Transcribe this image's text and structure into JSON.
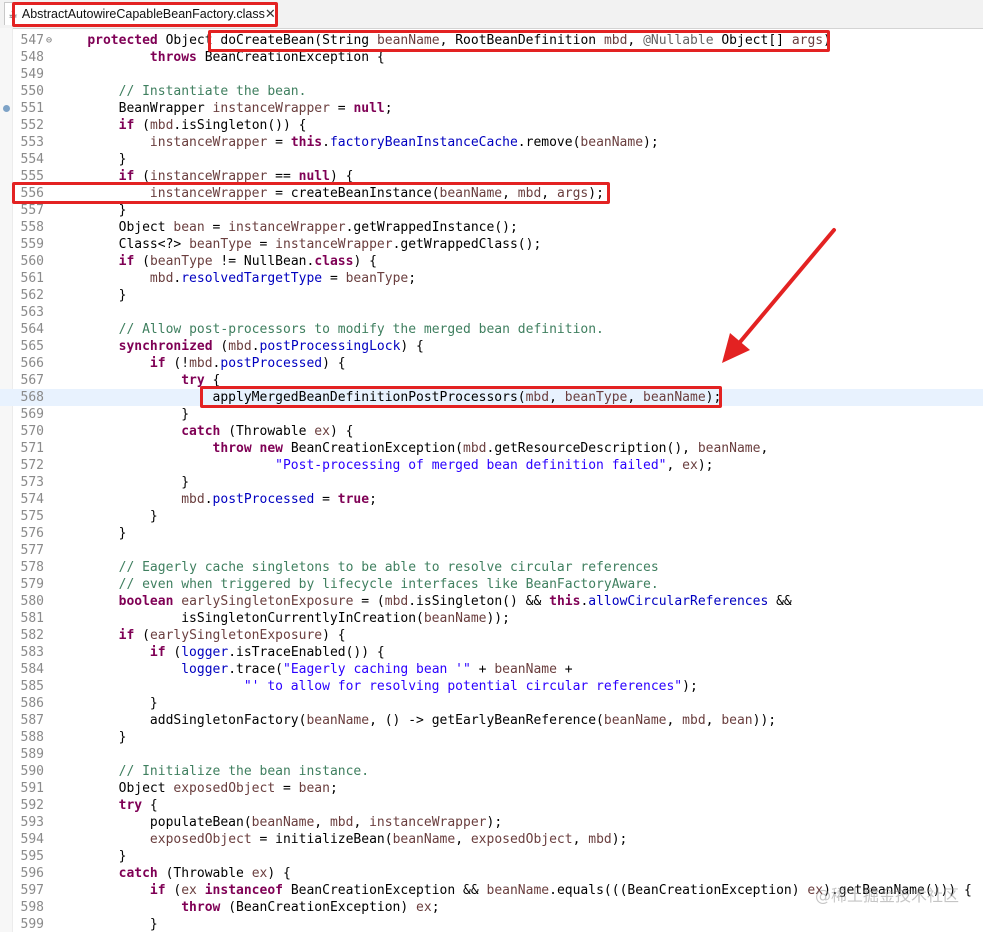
{
  "tab": {
    "title": "AbstractAutowireCapableBeanFactory.class",
    "icon": "java-class-file-icon",
    "close_glyph": "✕"
  },
  "editor": {
    "lines": [
      {
        "num": "547",
        "fold": "⊖",
        "segs": [
          [
            "",
            "    "
          ],
          [
            "kw",
            "protected"
          ],
          [
            "",
            " Object "
          ],
          [
            "",
            "doCreateBean(String "
          ],
          [
            "vr",
            "beanName"
          ],
          [
            "",
            ", RootBeanDefinition "
          ],
          [
            "vr",
            "mbd"
          ],
          [
            "",
            ", "
          ],
          [
            "an",
            "@Nullable"
          ],
          [
            "",
            " Object[] "
          ],
          [
            "vr",
            "args"
          ],
          [
            "",
            ")"
          ]
        ]
      },
      {
        "num": "548",
        "segs": [
          [
            "",
            "            "
          ],
          [
            "kw",
            "throws"
          ],
          [
            "",
            " BeanCreationException {"
          ]
        ]
      },
      {
        "num": "549",
        "segs": []
      },
      {
        "num": "550",
        "segs": [
          [
            "",
            "        "
          ],
          [
            "cm",
            "// Instantiate the bean."
          ]
        ]
      },
      {
        "num": "551",
        "marker": true,
        "segs": [
          [
            "",
            "        BeanWrapper "
          ],
          [
            "vr",
            "instanceWrapper"
          ],
          [
            "",
            " = "
          ],
          [
            "kw",
            "null"
          ],
          [
            "",
            ";"
          ]
        ]
      },
      {
        "num": "552",
        "segs": [
          [
            "",
            "        "
          ],
          [
            "kw",
            "if"
          ],
          [
            "",
            " ("
          ],
          [
            "vr",
            "mbd"
          ],
          [
            "",
            ".isSingleton()) {"
          ]
        ]
      },
      {
        "num": "553",
        "segs": [
          [
            "",
            "            "
          ],
          [
            "vr",
            "instanceWrapper"
          ],
          [
            "",
            " = "
          ],
          [
            "kw",
            "this"
          ],
          [
            "",
            "."
          ],
          [
            "fd",
            "factoryBeanInstanceCache"
          ],
          [
            "",
            ".remove("
          ],
          [
            "vr",
            "beanName"
          ],
          [
            "",
            ");"
          ]
        ]
      },
      {
        "num": "554",
        "segs": [
          [
            "",
            "        }"
          ]
        ]
      },
      {
        "num": "555",
        "segs": [
          [
            "",
            "        "
          ],
          [
            "kw",
            "if"
          ],
          [
            "",
            " ("
          ],
          [
            "vr",
            "instanceWrapper"
          ],
          [
            "",
            " == "
          ],
          [
            "kw",
            "null"
          ],
          [
            "",
            ") {"
          ]
        ]
      },
      {
        "num": "556",
        "segs": [
          [
            "",
            "            "
          ],
          [
            "vr",
            "instanceWrapper"
          ],
          [
            "",
            " = createBeanInstance("
          ],
          [
            "vr",
            "beanName"
          ],
          [
            "",
            ", "
          ],
          [
            "vr",
            "mbd"
          ],
          [
            "",
            ", "
          ],
          [
            "vr",
            "args"
          ],
          [
            "",
            ");"
          ]
        ]
      },
      {
        "num": "557",
        "segs": [
          [
            "",
            "        }"
          ]
        ]
      },
      {
        "num": "558",
        "segs": [
          [
            "",
            "        Object "
          ],
          [
            "vr",
            "bean"
          ],
          [
            "",
            " = "
          ],
          [
            "vr",
            "instanceWrapper"
          ],
          [
            "",
            ".getWrappedInstance();"
          ]
        ]
      },
      {
        "num": "559",
        "segs": [
          [
            "",
            "        Class<?> "
          ],
          [
            "vr",
            "beanType"
          ],
          [
            "",
            " = "
          ],
          [
            "vr",
            "instanceWrapper"
          ],
          [
            "",
            ".getWrappedClass();"
          ]
        ]
      },
      {
        "num": "560",
        "segs": [
          [
            "",
            "        "
          ],
          [
            "kw",
            "if"
          ],
          [
            "",
            " ("
          ],
          [
            "vr",
            "beanType"
          ],
          [
            "",
            " != NullBean."
          ],
          [
            "kw",
            "class"
          ],
          [
            "",
            ") {"
          ]
        ]
      },
      {
        "num": "561",
        "segs": [
          [
            "",
            "            "
          ],
          [
            "vr",
            "mbd"
          ],
          [
            "",
            "."
          ],
          [
            "fd",
            "resolvedTargetType"
          ],
          [
            "",
            " = "
          ],
          [
            "vr",
            "beanType"
          ],
          [
            "",
            ";"
          ]
        ]
      },
      {
        "num": "562",
        "segs": [
          [
            "",
            "        }"
          ]
        ]
      },
      {
        "num": "563",
        "segs": []
      },
      {
        "num": "564",
        "segs": [
          [
            "",
            "        "
          ],
          [
            "cm",
            "// Allow post-processors to modify the merged bean definition."
          ]
        ]
      },
      {
        "num": "565",
        "segs": [
          [
            "",
            "        "
          ],
          [
            "kw",
            "synchronized"
          ],
          [
            "",
            " ("
          ],
          [
            "vr",
            "mbd"
          ],
          [
            "",
            "."
          ],
          [
            "fd",
            "postProcessingLock"
          ],
          [
            "",
            ") {"
          ]
        ]
      },
      {
        "num": "566",
        "segs": [
          [
            "",
            "            "
          ],
          [
            "kw",
            "if"
          ],
          [
            "",
            " (!"
          ],
          [
            "vr",
            "mbd"
          ],
          [
            "",
            "."
          ],
          [
            "fd",
            "postProcessed"
          ],
          [
            "",
            ") {"
          ]
        ]
      },
      {
        "num": "567",
        "segs": [
          [
            "",
            "                "
          ],
          [
            "kw",
            "try"
          ],
          [
            "",
            " {"
          ]
        ]
      },
      {
        "num": "568",
        "current": true,
        "segs": [
          [
            "",
            "                    applyMergedBeanDefinitionPostProcessors("
          ],
          [
            "vr",
            "mbd"
          ],
          [
            "",
            ", "
          ],
          [
            "vr",
            "beanType"
          ],
          [
            "",
            ", "
          ],
          [
            "vr",
            "beanName"
          ],
          [
            "",
            ");"
          ]
        ]
      },
      {
        "num": "569",
        "segs": [
          [
            "",
            "                }"
          ]
        ]
      },
      {
        "num": "570",
        "segs": [
          [
            "",
            "                "
          ],
          [
            "kw",
            "catch"
          ],
          [
            "",
            " (Throwable "
          ],
          [
            "vr",
            "ex"
          ],
          [
            "",
            ") {"
          ]
        ]
      },
      {
        "num": "571",
        "segs": [
          [
            "",
            "                    "
          ],
          [
            "kw",
            "throw"
          ],
          [
            "",
            " "
          ],
          [
            "kw",
            "new"
          ],
          [
            "",
            " BeanCreationException("
          ],
          [
            "vr",
            "mbd"
          ],
          [
            "",
            ".getResourceDescription(), "
          ],
          [
            "vr",
            "beanName"
          ],
          [
            "",
            ","
          ]
        ]
      },
      {
        "num": "572",
        "segs": [
          [
            "",
            "                            "
          ],
          [
            "st",
            "\"Post-processing of merged bean definition failed\""
          ],
          [
            "",
            ", "
          ],
          [
            "vr",
            "ex"
          ],
          [
            "",
            ");"
          ]
        ]
      },
      {
        "num": "573",
        "segs": [
          [
            "",
            "                }"
          ]
        ]
      },
      {
        "num": "574",
        "segs": [
          [
            "",
            "                "
          ],
          [
            "vr",
            "mbd"
          ],
          [
            "",
            "."
          ],
          [
            "fd",
            "postProcessed"
          ],
          [
            "",
            " = "
          ],
          [
            "kw",
            "true"
          ],
          [
            "",
            ";"
          ]
        ]
      },
      {
        "num": "575",
        "segs": [
          [
            "",
            "            }"
          ]
        ]
      },
      {
        "num": "576",
        "segs": [
          [
            "",
            "        }"
          ]
        ]
      },
      {
        "num": "577",
        "segs": []
      },
      {
        "num": "578",
        "segs": [
          [
            "",
            "        "
          ],
          [
            "cm",
            "// Eagerly cache singletons to be able to resolve circular references"
          ]
        ]
      },
      {
        "num": "579",
        "segs": [
          [
            "",
            "        "
          ],
          [
            "cm",
            "// even when triggered by lifecycle interfaces like BeanFactoryAware."
          ]
        ]
      },
      {
        "num": "580",
        "segs": [
          [
            "",
            "        "
          ],
          [
            "kw",
            "boolean"
          ],
          [
            "",
            " "
          ],
          [
            "vr",
            "earlySingletonExposure"
          ],
          [
            "",
            " = ("
          ],
          [
            "vr",
            "mbd"
          ],
          [
            "",
            ".isSingleton() && "
          ],
          [
            "kw",
            "this"
          ],
          [
            "",
            "."
          ],
          [
            "fd",
            "allowCircularReferences"
          ],
          [
            "",
            " &&"
          ]
        ]
      },
      {
        "num": "581",
        "segs": [
          [
            "",
            "                isSingletonCurrentlyInCreation("
          ],
          [
            "vr",
            "beanName"
          ],
          [
            "",
            "));"
          ]
        ]
      },
      {
        "num": "582",
        "segs": [
          [
            "",
            "        "
          ],
          [
            "kw",
            "if"
          ],
          [
            "",
            " ("
          ],
          [
            "vr",
            "earlySingletonExposure"
          ],
          [
            "",
            ") {"
          ]
        ]
      },
      {
        "num": "583",
        "segs": [
          [
            "",
            "            "
          ],
          [
            "kw",
            "if"
          ],
          [
            "",
            " ("
          ],
          [
            "fd",
            "logger"
          ],
          [
            "",
            ".isTraceEnabled()) {"
          ]
        ]
      },
      {
        "num": "584",
        "segs": [
          [
            "",
            "                "
          ],
          [
            "fd",
            "logger"
          ],
          [
            "",
            ".trace("
          ],
          [
            "st",
            "\"Eagerly caching bean '\""
          ],
          [
            "",
            " + "
          ],
          [
            "vr",
            "beanName"
          ],
          [
            "",
            " +"
          ]
        ]
      },
      {
        "num": "585",
        "segs": [
          [
            "",
            "                        "
          ],
          [
            "st",
            "\"' to allow for resolving potential circular references\""
          ],
          [
            "",
            ");"
          ]
        ]
      },
      {
        "num": "586",
        "segs": [
          [
            "",
            "            }"
          ]
        ]
      },
      {
        "num": "587",
        "segs": [
          [
            "",
            "            addSingletonFactory("
          ],
          [
            "vr",
            "beanName"
          ],
          [
            "",
            ", () -> getEarlyBeanReference("
          ],
          [
            "vr",
            "beanName"
          ],
          [
            "",
            ", "
          ],
          [
            "vr",
            "mbd"
          ],
          [
            "",
            ", "
          ],
          [
            "vr",
            "bean"
          ],
          [
            "",
            "));"
          ]
        ]
      },
      {
        "num": "588",
        "segs": [
          [
            "",
            "        }"
          ]
        ]
      },
      {
        "num": "589",
        "segs": []
      },
      {
        "num": "590",
        "segs": [
          [
            "",
            "        "
          ],
          [
            "cm",
            "// Initialize the bean instance."
          ]
        ]
      },
      {
        "num": "591",
        "segs": [
          [
            "",
            "        Object "
          ],
          [
            "vr",
            "exposedObject"
          ],
          [
            "",
            " = "
          ],
          [
            "vr",
            "bean"
          ],
          [
            "",
            ";"
          ]
        ]
      },
      {
        "num": "592",
        "segs": [
          [
            "",
            "        "
          ],
          [
            "kw",
            "try"
          ],
          [
            "",
            " {"
          ]
        ]
      },
      {
        "num": "593",
        "segs": [
          [
            "",
            "            populateBean("
          ],
          [
            "vr",
            "beanName"
          ],
          [
            "",
            ", "
          ],
          [
            "vr",
            "mbd"
          ],
          [
            "",
            ", "
          ],
          [
            "vr",
            "instanceWrapper"
          ],
          [
            "",
            ");"
          ]
        ]
      },
      {
        "num": "594",
        "segs": [
          [
            "",
            "            "
          ],
          [
            "vr",
            "exposedObject"
          ],
          [
            "",
            " = initializeBean("
          ],
          [
            "vr",
            "beanName"
          ],
          [
            "",
            ", "
          ],
          [
            "vr",
            "exposedObject"
          ],
          [
            "",
            ", "
          ],
          [
            "vr",
            "mbd"
          ],
          [
            "",
            ");"
          ]
        ]
      },
      {
        "num": "595",
        "segs": [
          [
            "",
            "        }"
          ]
        ]
      },
      {
        "num": "596",
        "segs": [
          [
            "",
            "        "
          ],
          [
            "kw",
            "catch"
          ],
          [
            "",
            " (Throwable "
          ],
          [
            "vr",
            "ex"
          ],
          [
            "",
            ") {"
          ]
        ]
      },
      {
        "num": "597",
        "segs": [
          [
            "",
            "            "
          ],
          [
            "kw",
            "if"
          ],
          [
            "",
            " ("
          ],
          [
            "vr",
            "ex"
          ],
          [
            "",
            " "
          ],
          [
            "kw",
            "instanceof"
          ],
          [
            "",
            " BeanCreationException && "
          ],
          [
            "vr",
            "beanName"
          ],
          [
            "",
            ".equals(((BeanCreationException) "
          ],
          [
            "vr",
            "ex"
          ],
          [
            "",
            ").getBeanName())) {"
          ]
        ]
      },
      {
        "num": "598",
        "segs": [
          [
            "",
            "                "
          ],
          [
            "kw",
            "throw"
          ],
          [
            "",
            " (BeanCreationException) "
          ],
          [
            "vr",
            "ex"
          ],
          [
            "",
            ";"
          ]
        ]
      },
      {
        "num": "599",
        "segs": [
          [
            "",
            "            }"
          ]
        ]
      }
    ]
  },
  "watermark": "@稀土掘金技术社区",
  "colors": {
    "highlight_box": "#e32222",
    "current_line": "#e8f2fe",
    "keyword": "#7f0055",
    "comment": "#3f7f5f",
    "string": "#2a00ff",
    "field": "#0000c0"
  }
}
